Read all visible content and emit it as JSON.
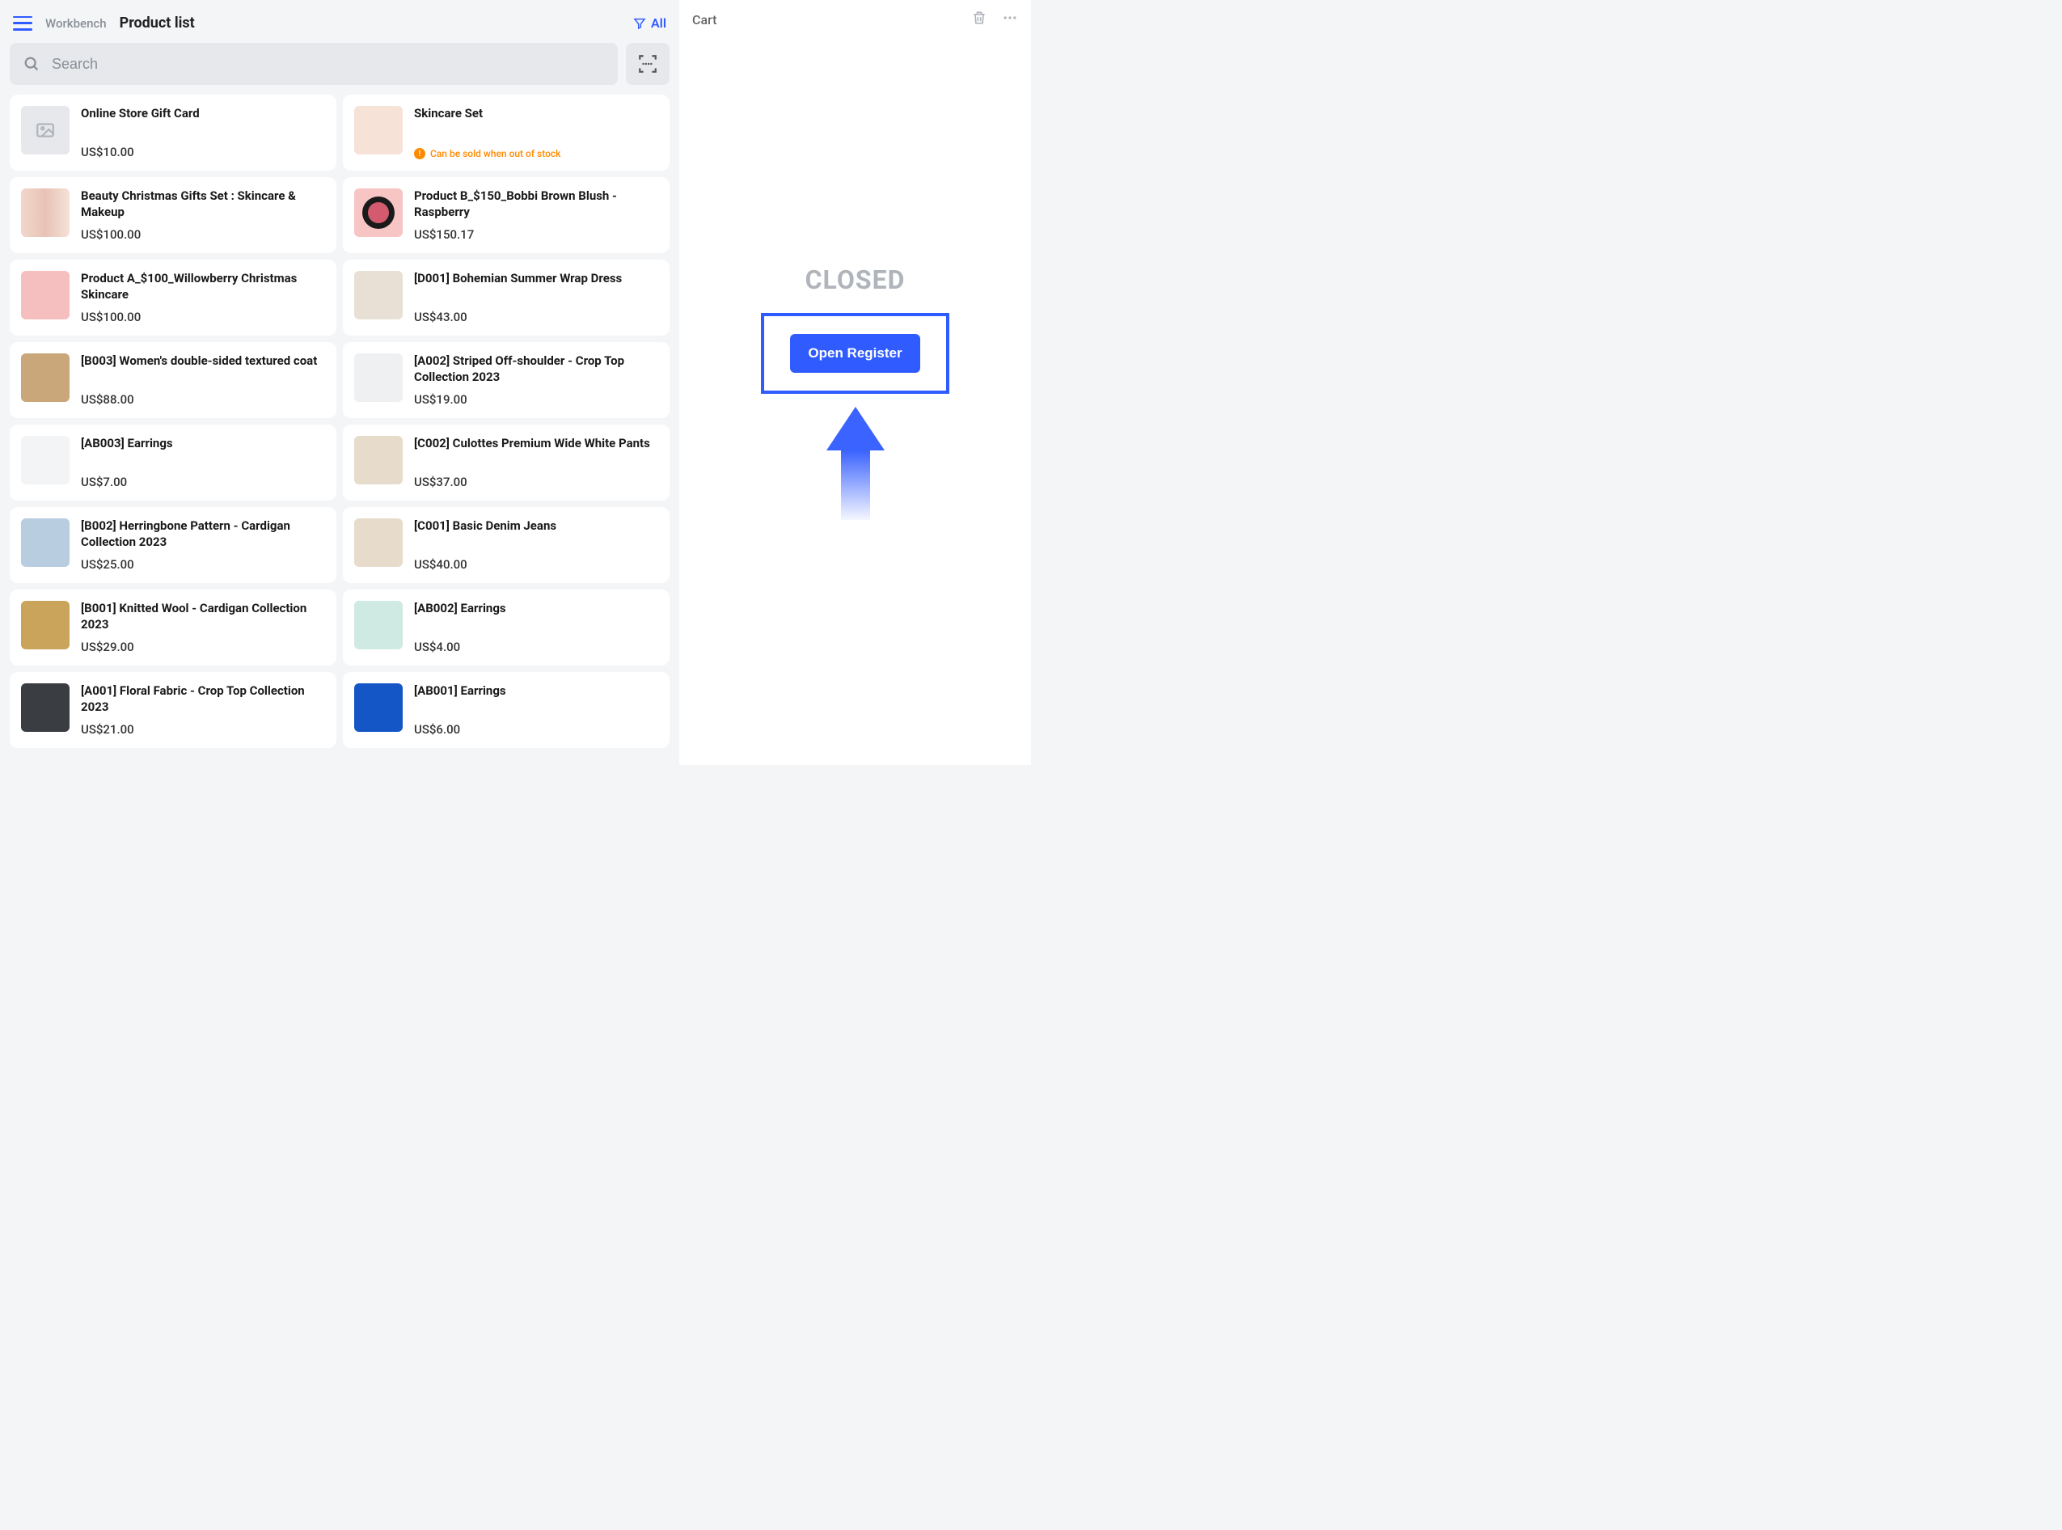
{
  "header": {
    "breadcrumb": "Workbench",
    "title": "Product list",
    "filter_label": "All"
  },
  "search": {
    "placeholder": "Search"
  },
  "products": [
    {
      "name": "Online Store Gift Card",
      "price": "US$10.00",
      "thumb": "th-placeholder"
    },
    {
      "name": "Skincare Set",
      "price": "",
      "thumb": "th-pastel",
      "oos_warning": "Can be sold when out of stock"
    },
    {
      "name": "Beauty Christmas Gifts Set : Skincare & Makeup",
      "price": "US$100.00",
      "thumb": "th-gifts"
    },
    {
      "name": "Product B_$150_Bobbi Brown Blush - Raspberry",
      "price": "US$150.17",
      "thumb": "th-pink"
    },
    {
      "name": "Product A_$100_Willowberry Christmas Skincare",
      "price": "US$100.00",
      "thumb": "th-pinkroom"
    },
    {
      "name": "[D001] Bohemian Summer Wrap Dress",
      "price": "US$43.00",
      "thumb": "th-cream"
    },
    {
      "name": "[B003] Women's double-sided textured coat",
      "price": "US$88.00",
      "thumb": "th-tan"
    },
    {
      "name": "[A002] Striped Off-shoulder - Crop Top Collection 2023",
      "price": "US$19.00",
      "thumb": "th-white"
    },
    {
      "name": "[AB003] Earrings",
      "price": "US$7.00",
      "thumb": "th-light"
    },
    {
      "name": "[C002] Culottes Premium Wide White Pants",
      "price": "US$37.00",
      "thumb": "th-warm"
    },
    {
      "name": "[B002] Herringbone Pattern - Cardigan Collection 2023",
      "price": "US$25.00",
      "thumb": "th-denim"
    },
    {
      "name": "[C001] Basic Denim Jeans",
      "price": "US$40.00",
      "thumb": "th-warm"
    },
    {
      "name": "[B001] Knitted Wool - Cardigan Collection 2023",
      "price": "US$29.00",
      "thumb": "th-mustard"
    },
    {
      "name": "[AB002] Earrings",
      "price": "US$4.00",
      "thumb": "th-teal"
    },
    {
      "name": "[A001] Floral Fabric - Crop Top Collection 2023",
      "price": "US$21.00",
      "thumb": "th-dark"
    },
    {
      "name": "[AB001] Earrings",
      "price": "US$6.00",
      "thumb": "th-blue"
    }
  ],
  "cart": {
    "title": "Cart",
    "status": "CLOSED",
    "open_button": "Open Register"
  }
}
